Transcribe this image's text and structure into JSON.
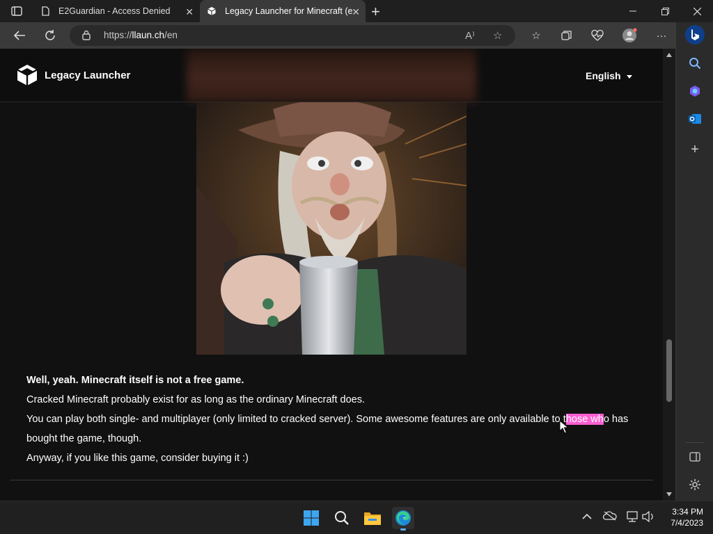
{
  "tabs": [
    {
      "title": "E2Guardian - Access Denied"
    },
    {
      "title": "Legacy Launcher for Minecraft (e"
    }
  ],
  "address": {
    "prefix": "https://",
    "host": "llaun.ch",
    "path": "/en"
  },
  "site": {
    "brand": "Legacy Launcher",
    "language": "English"
  },
  "article": {
    "lead": "Well, yeah. Minecraft itself is not a free game.",
    "line2": "Cracked Minecraft probably exist for as long as the ordinary Minecraft does.",
    "line3_pre": "You can play both single- and multiplayer (only limited to cracked server). Some awesome features are only available to t",
    "line3_hl": "hose wh",
    "line3_post": "o has bought the game, though.",
    "line4": "Anyway, if you like this game, consider buying it :)"
  },
  "clock": {
    "time": "3:34 PM",
    "date": "7/4/2023"
  },
  "colors": {
    "highlight": "#ff5fd2",
    "accent": "#5ab0ff"
  }
}
